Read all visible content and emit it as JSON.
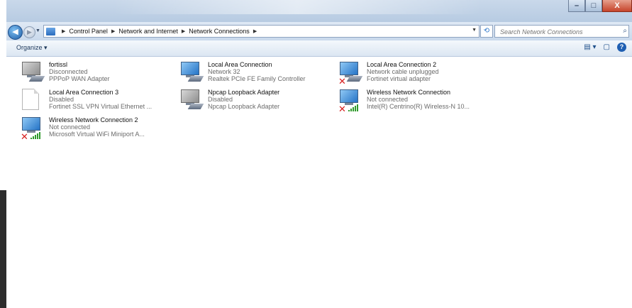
{
  "window": {
    "buttons": {
      "minimize": "–",
      "maximize": "□",
      "close": "X"
    }
  },
  "nav": {
    "back_icon": "back-arrow-icon",
    "forward_icon": "forward-arrow-icon",
    "breadcrumb": [
      "Control Panel",
      "Network and Internet",
      "Network Connections"
    ],
    "search_placeholder": "Search Network Connections"
  },
  "toolbar": {
    "organize_label": "Organize"
  },
  "connections": [
    {
      "name": "fortissl",
      "status": "Disconnected",
      "device": "PPPoP WAN Adapter",
      "icon": "monitor-dialup-icon",
      "state": "gray"
    },
    {
      "name": "Local Area Connection",
      "status": "Network  32",
      "device": "Realtek PCIe FE Family Controller",
      "icon": "lan-icon",
      "state": "ok"
    },
    {
      "name": "Local Area Connection 2",
      "status": "Network cable unplugged",
      "device": "Fortinet virtual adapter",
      "icon": "lan-unplugged-icon",
      "state": "x"
    },
    {
      "name": "Local Area Connection 3",
      "status": "Disabled",
      "device": "Fortinet SSL VPN Virtual Ethernet ...",
      "icon": "blank-document-icon",
      "state": "doc"
    },
    {
      "name": "Npcap Loopback Adapter",
      "status": "Disabled",
      "device": "Npcap Loopback Adapter",
      "icon": "lan-disabled-icon",
      "state": "gray"
    },
    {
      "name": "Wireless Network Connection",
      "status": "Not connected",
      "device": "Intel(R) Centrino(R) Wireless-N 10...",
      "icon": "wireless-disconnected-icon",
      "state": "wx"
    },
    {
      "name": "Wireless Network Connection 2",
      "status": "Not connected",
      "device": "Microsoft Virtual WiFi Miniport A...",
      "icon": "wireless-disconnected-icon",
      "state": "wx"
    }
  ]
}
